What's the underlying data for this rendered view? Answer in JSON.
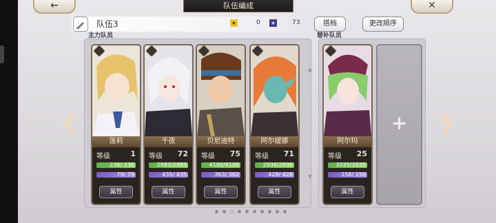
{
  "header": {
    "title": "队伍编成",
    "back_icon": "back-arrow-icon",
    "close_icon": "close-icon"
  },
  "team": {
    "name": "队伍3",
    "gold_value": "0",
    "blue_value": "73"
  },
  "buttons": {
    "dangan": "搭档",
    "change_order": "更改顺序"
  },
  "sections": {
    "main": "主力队员",
    "sub": "替补队员"
  },
  "labels": {
    "level": "等级",
    "attribute": "属性"
  },
  "members": [
    {
      "name": "莲莉",
      "level": "1",
      "hp": "236/ 236",
      "mp": "79/ 79"
    },
    {
      "name": "千夜",
      "level": "72",
      "hp": "2983/2983",
      "mp": "435/ 435"
    },
    {
      "name": "贝尼迪特",
      "level": "75",
      "hp": "4100/4100",
      "mp": "363/ 362"
    },
    {
      "name": "阿尔缇娜",
      "level": "71",
      "hp": "2936/2936",
      "mp": "428/ 428"
    },
    {
      "name": "阿尔玛",
      "level": "25",
      "hp": "1035/1035",
      "mp": "156/ 156"
    }
  ],
  "pagination": {
    "pages": 10,
    "current": 3
  },
  "colors": {
    "hp_bar": "#6fc050",
    "mp_bar": "#8f72d4",
    "accent": "#b8a47a"
  }
}
